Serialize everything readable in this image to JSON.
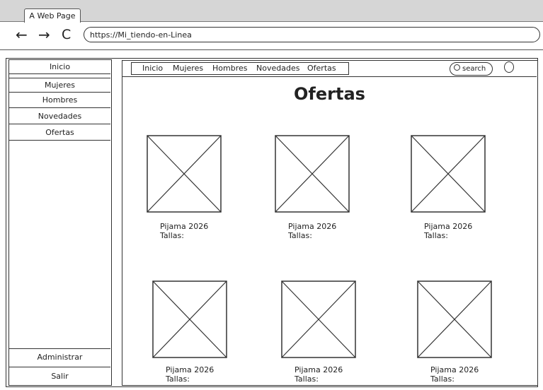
{
  "browser": {
    "tab_title": "A Web Page",
    "url": "https://Mi_tiendo-en-Linea"
  },
  "sidebar": {
    "items": [
      "Inicio",
      "Mujeres",
      "Hombres",
      "Novedades",
      "Ofertas"
    ],
    "bottom_items": [
      "Administrar",
      "Salir"
    ]
  },
  "topnav": {
    "items": [
      "Inicio",
      "Mujeres",
      "Hombres",
      "Novedades",
      "Ofertas"
    ]
  },
  "search": {
    "placeholder": "search"
  },
  "main": {
    "title": "Ofertas",
    "products": [
      {
        "name": "Pijama 2026",
        "sizes_label": "Tallas:"
      },
      {
        "name": "Pijama 2026",
        "sizes_label": "Tallas:"
      },
      {
        "name": "Pijama 2026",
        "sizes_label": "Tallas:"
      },
      {
        "name": "Pijama 2026",
        "sizes_label": "Tallas:"
      },
      {
        "name": "Pijama 2026",
        "sizes_label": "Tallas:"
      },
      {
        "name": "Pijama 2026",
        "sizes_label": "Tallas:"
      }
    ]
  }
}
